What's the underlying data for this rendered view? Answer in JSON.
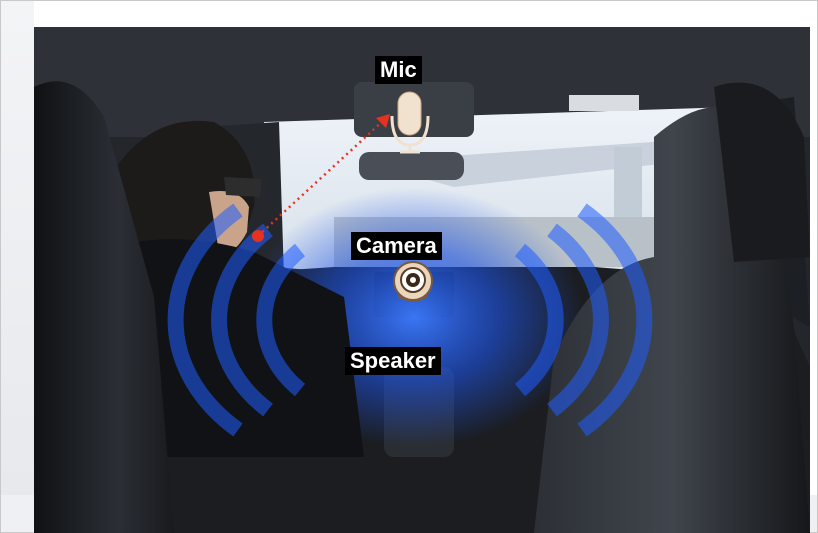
{
  "labels": {
    "mic": "Mic",
    "camera": "Camera",
    "speaker": "Speaker"
  },
  "icons": {
    "mic": "microphone-icon",
    "camera": "webcam-icon"
  },
  "colors": {
    "label_bg": "#000000",
    "label_text": "#ffffff",
    "sound_wave": "#1f5cff",
    "pointer_line": "#e8321e"
  }
}
